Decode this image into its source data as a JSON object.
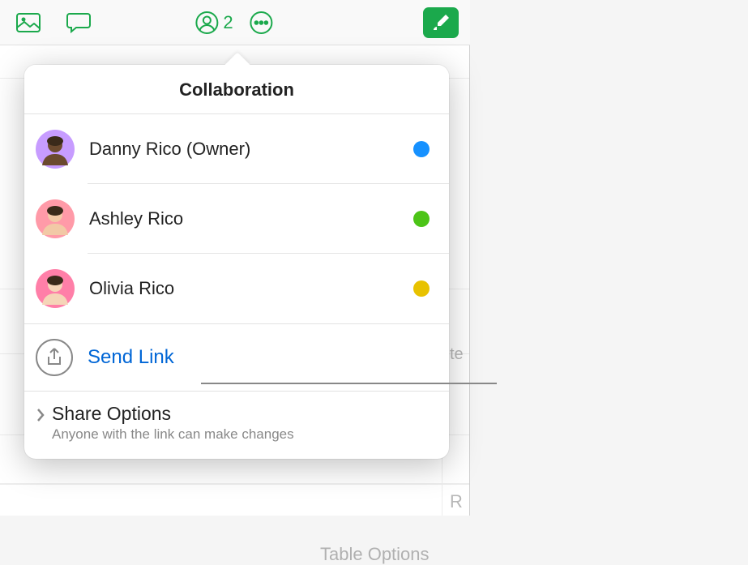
{
  "toolbar": {
    "collab_count": "2"
  },
  "popover": {
    "title": "Collaboration",
    "participants": [
      {
        "name": "Danny Rico (Owner)",
        "color": "#1691ff",
        "avatar_bg": "#c79cff",
        "avatar_skin": "#6b4a2e"
      },
      {
        "name": "Ashley Rico",
        "color": "#4cc417",
        "avatar_bg": "#ff9aa8",
        "avatar_skin": "#f2c9a6"
      },
      {
        "name": "Olivia Rico",
        "color": "#e8c200",
        "avatar_bg": "#ff7fa8",
        "avatar_skin": "#f5d5b8"
      }
    ],
    "send_link": "Send Link",
    "share_options_title": "Share Options",
    "share_options_sub": "Anyone with the link can make changes"
  },
  "bg": {
    "text_right_1": "te",
    "text_right_2": "R",
    "text_bottom": "Table Options"
  }
}
